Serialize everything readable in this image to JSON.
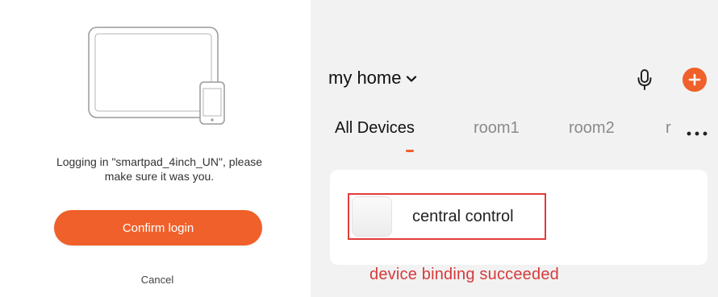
{
  "login": {
    "message_line1": "Logging in \"smartpad_4inch_UN\", please",
    "message_line2": "make sure it was you.",
    "confirm_label": "Confirm login",
    "cancel_label": "Cancel"
  },
  "home": {
    "title": "my home",
    "tabs": [
      {
        "label": "All Devices",
        "active": true
      },
      {
        "label": "room1",
        "active": false
      },
      {
        "label": "room2",
        "active": false
      },
      {
        "label": "r",
        "active": false
      }
    ],
    "device": {
      "name": "central control"
    },
    "status_caption": "device binding succeeded"
  },
  "colors": {
    "accent": "#f0602a",
    "highlight_border": "#e23b3b",
    "caption_red": "#d63a3a"
  },
  "icons": [
    "tablet-phone-illustration",
    "chevron-down-icon",
    "microphone-icon",
    "plus-icon",
    "more-icon"
  ]
}
